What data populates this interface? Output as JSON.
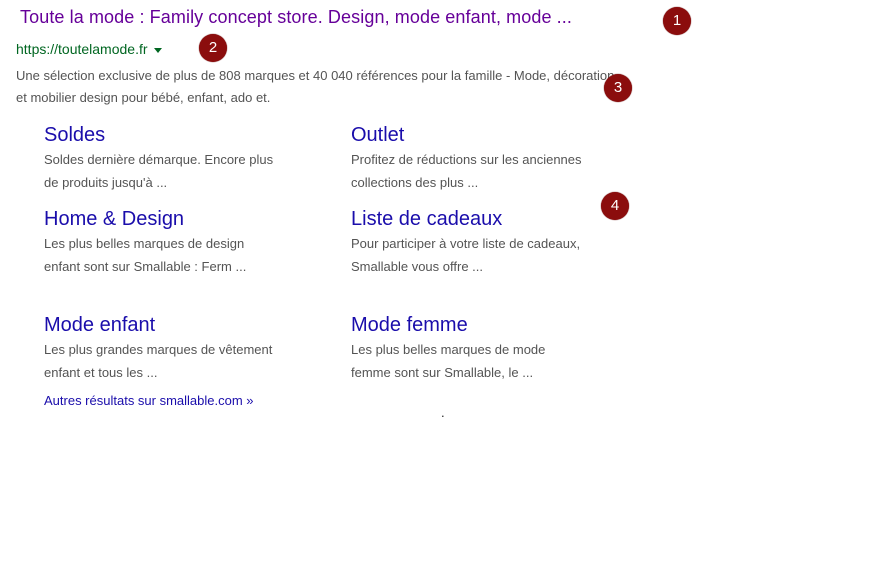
{
  "result": {
    "title": "Toute la mode  : Family concept store. Design, mode enfant, mode ...",
    "url": "https://toutelamode.fr",
    "url_arrow_icon": "dropdown-arrow-icon",
    "snippet": "Une sélection exclusive de plus de 808 marques et 40 040 références pour la famille - Mode, décoration et mobilier design pour bébé, enfant, ado et."
  },
  "sitelinks": [
    {
      "title": "Soldes",
      "desc": "Soldes dernière démarque. Encore plus de produits jusqu'à ..."
    },
    {
      "title": "Outlet",
      "desc": "Profitez de réductions sur les anciennes collections des plus ..."
    },
    {
      "title": "Home & Design",
      "desc": "Les plus belles marques de design enfant sont sur Smallable : Ferm ..."
    },
    {
      "title": "Liste de cadeaux",
      "desc": "Pour participer à votre liste de cadeaux, Smallable vous offre ..."
    },
    {
      "title": "Mode enfant",
      "desc": "Les plus grandes marques de vêtement enfant et tous les ..."
    },
    {
      "title": "Mode femme",
      "desc": "Les plus belles marques de mode femme sont sur Smallable, le ..."
    }
  ],
  "more_results": "Autres résultats sur smallable.com »",
  "stray_dot": ".",
  "badges": [
    "1",
    "2",
    "3",
    "4"
  ],
  "colors": {
    "visited_title": "#660099",
    "url_green": "#006621",
    "link_blue": "#1a0dab",
    "snippet_gray": "#545454",
    "badge_red": "#8b0d0d"
  }
}
